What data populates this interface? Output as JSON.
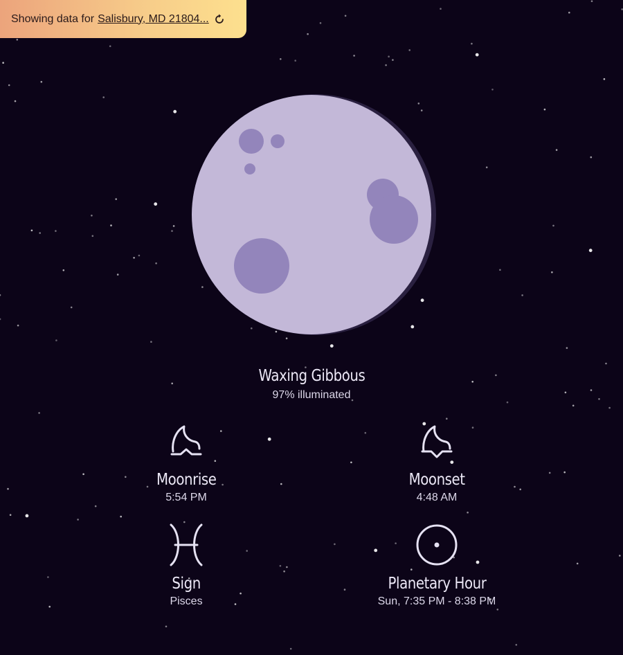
{
  "location": {
    "prefix": "Showing data for",
    "place": "Salisbury, MD 21804..."
  },
  "moon": {
    "phase_name": "Waxing Gibbous",
    "illumination_text": "97% illuminated",
    "illumination_fraction": 0.97
  },
  "stats": {
    "moonrise": {
      "label": "Moonrise",
      "value": "5:54 PM",
      "icon": "moonrise-icon"
    },
    "moonset": {
      "label": "Moonset",
      "value": "4:48 AM",
      "icon": "moonset-icon"
    },
    "sign": {
      "label": "Sign",
      "value": "Pisces",
      "icon": "pisces-icon"
    },
    "planetary_hour": {
      "label": "Planetary Hour",
      "value": "Sun, 7:35 PM - 8:38 PM",
      "icon": "sun-symbol-icon"
    }
  },
  "colors": {
    "background": "#0c0418",
    "moon_face": "#c3b8d8",
    "moon_crater": "#9385bb",
    "moon_shadow": "#2a2040",
    "pill_gradient_start": "#eca47c",
    "pill_gradient_end": "#fde08e",
    "icon_stroke": "#e6e2f3"
  }
}
